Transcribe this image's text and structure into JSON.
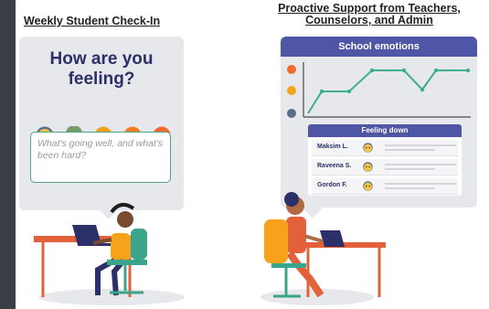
{
  "left_panel": {
    "title": "Weekly Student Check-In",
    "question": "How are you feeling?",
    "emotions": [
      "very-upset-face-icon",
      "sad-face-icon",
      "neutral-face-icon",
      "content-face-icon",
      "happy-face-icon"
    ],
    "input_placeholder": "What's going well, and what's been hard?"
  },
  "right_panel": {
    "title": "Proactive Support from Teachers, Counselors, and Admin",
    "chart_header": "School emotions",
    "feeling_down_header": "Feeling down",
    "students": [
      "Maksim L.",
      "Raveena S.",
      "Gordon F."
    ]
  },
  "colors": {
    "navy": "#2c3068",
    "header_purple": "#4f56a5",
    "line_teal": "#3fae8f",
    "desk_orange": "#e2603a",
    "chair_teal": "#3aa58a"
  }
}
